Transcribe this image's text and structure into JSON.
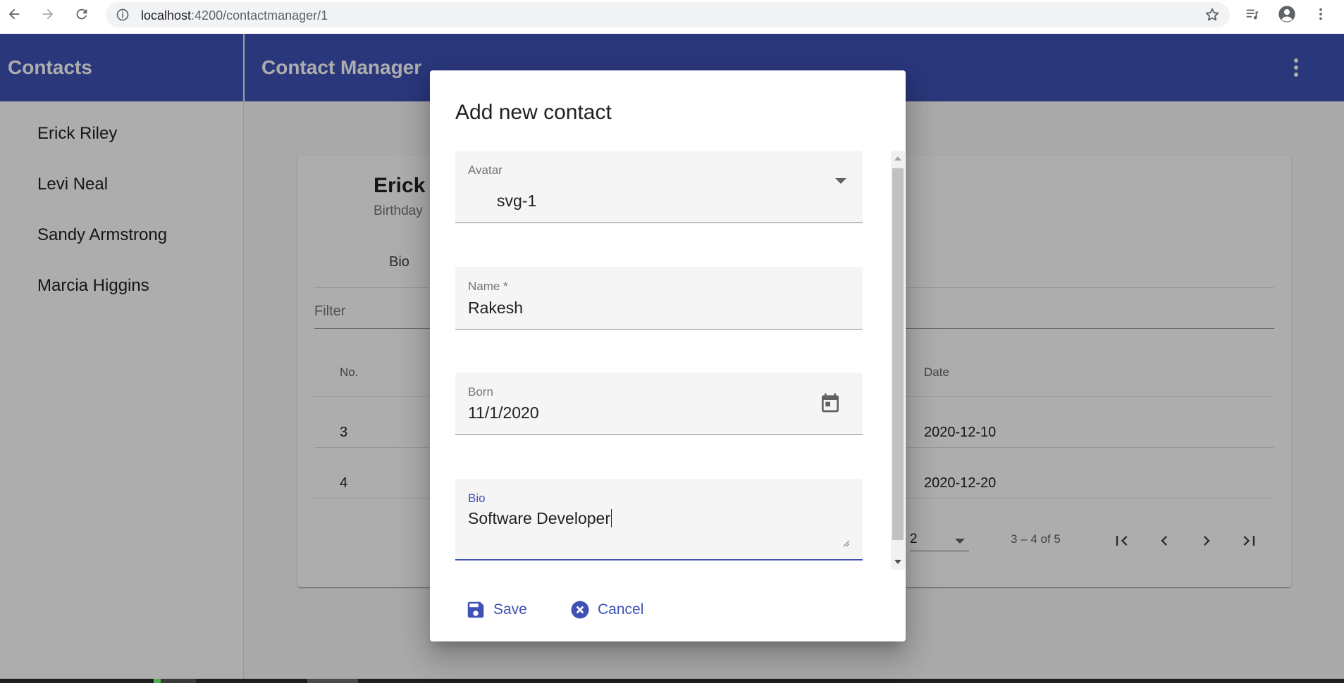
{
  "browser": {
    "url_host": "localhost",
    "url_path": ":4200/contactmanager/1"
  },
  "sidebar": {
    "title": "Contacts",
    "contacts": [
      "Erick Riley",
      "Levi Neal",
      "Sandy Armstrong",
      "Marcia Higgins"
    ]
  },
  "toolbar": {
    "title": "Contact Manager"
  },
  "detail": {
    "name": "Erick l",
    "birthday_label": "Birthday",
    "tab_bio": "Bio",
    "filter_placeholder": "Filter",
    "table": {
      "col_no": "No.",
      "col_date": "Date",
      "rows": [
        {
          "no": "3",
          "date": "2020-12-10"
        },
        {
          "no": "4",
          "date": "2020-12-20"
        }
      ]
    },
    "paginator": {
      "page_size": "2",
      "range": "3 – 4 of 5"
    }
  },
  "dialog": {
    "title": "Add new contact",
    "avatar_label": "Avatar",
    "avatar_value": "svg-1",
    "name_label": "Name *",
    "name_value": "Rakesh",
    "born_label": "Born",
    "born_value": "11/1/2020",
    "bio_label": "Bio",
    "bio_value": "Software Developer",
    "save_label": "Save",
    "cancel_label": "Cancel"
  },
  "colors": {
    "primary": "#3f51b5"
  }
}
